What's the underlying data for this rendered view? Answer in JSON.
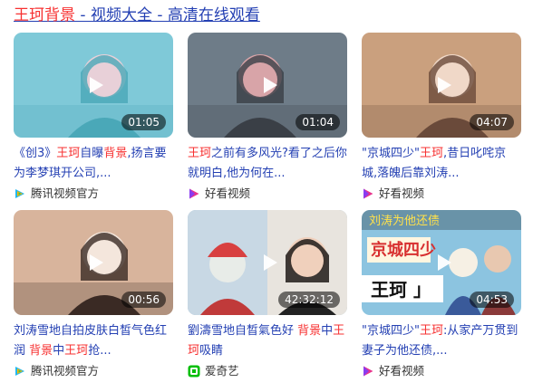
{
  "header": {
    "title_parts": [
      {
        "text": "王珂背景",
        "hl": true
      },
      {
        "text": " - 视频大全 - 高清在线观看",
        "hl": false
      }
    ]
  },
  "cards": [
    {
      "duration": "01:05",
      "title_parts": [
        {
          "text": "《创3》",
          "hl": false
        },
        {
          "text": "王珂",
          "hl": true
        },
        {
          "text": "自曝",
          "hl": false
        },
        {
          "text": "背景",
          "hl": true
        },
        {
          "text": ",扬言要为李梦琪开公司,...",
          "hl": false
        }
      ],
      "source": "腾讯视频官方",
      "source_icon": "tencent-video-icon",
      "palette": [
        "#7fc9d8",
        "#e8d0d8",
        "#4aa8b8"
      ]
    },
    {
      "duration": "01:04",
      "title_parts": [
        {
          "text": "王珂",
          "hl": true
        },
        {
          "text": "之前有多风光?看了之后你就明白,他为何在...",
          "hl": false
        }
      ],
      "source": "好看视频",
      "source_icon": "haokan-video-icon",
      "palette": [
        "#6e7c88",
        "#d8a4a8",
        "#3a3f46"
      ]
    },
    {
      "duration": "04:07",
      "title_parts": [
        {
          "text": "\"京城四少\"",
          "hl": false
        },
        {
          "text": "王珂",
          "hl": true
        },
        {
          "text": ",昔日叱咤京城,落魄后靠刘涛...",
          "hl": false
        }
      ],
      "source": "好看视频",
      "source_icon": "haokan-video-icon",
      "palette": [
        "#caa07e",
        "#f0d8c8",
        "#6a4a3a"
      ]
    },
    {
      "duration": "00:56",
      "title_parts": [
        {
          "text": "刘涛雪地自拍皮肤白皙气色红润 ",
          "hl": false
        },
        {
          "text": "背景",
          "hl": true
        },
        {
          "text": "中",
          "hl": false
        },
        {
          "text": "王珂",
          "hl": true
        },
        {
          "text": "抢...",
          "hl": false
        }
      ],
      "source": "腾讯视频官方",
      "source_icon": "tencent-video-icon",
      "palette": [
        "#d8b49c",
        "#f4e6dc",
        "#3a2a24"
      ]
    },
    {
      "duration": "42:32:12",
      "title_parts": [
        {
          "text": "劉濤雪地自晳氣色好 ",
          "hl": false
        },
        {
          "text": "背景",
          "hl": true
        },
        {
          "text": "中",
          "hl": false
        },
        {
          "text": "王珂",
          "hl": true
        },
        {
          "text": "吸睛",
          "hl": false
        }
      ],
      "source": "爱奇艺",
      "source_icon": "iqiyi-icon",
      "palette": [
        "#9ab8c8",
        "#e8ece8",
        "#d84040"
      ]
    },
    {
      "duration": "04:53",
      "title_parts": [
        {
          "text": "\"京城四少\"",
          "hl": false
        },
        {
          "text": "王珂",
          "hl": true
        },
        {
          "text": ":从家产万贯到妻子为他还债,...",
          "hl": false
        }
      ],
      "source": "好看视频",
      "source_icon": "haokan-video-icon",
      "palette": [
        "#8cc4e0",
        "#f6f0e4",
        "#d83030"
      ],
      "overlay_text": [
        "刘涛为他还债",
        "京城四少",
        "王珂 」"
      ]
    }
  ],
  "colors": {
    "link": "#2440b3",
    "highlight": "#f73131",
    "tencent": "#1fb8f0",
    "haokan": "#e8338c",
    "iqiyi": "#00be06"
  }
}
